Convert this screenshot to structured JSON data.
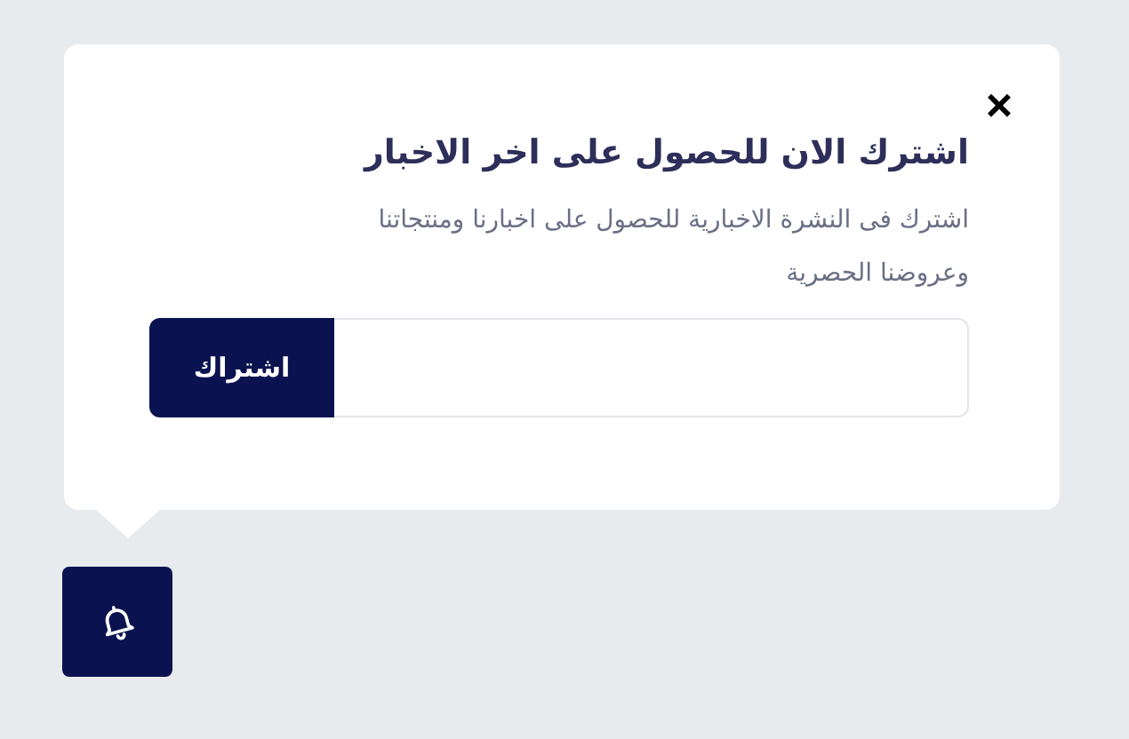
{
  "popup": {
    "close": "×",
    "title": "اشترك الان للحصول على اخر الاخبار",
    "description": "اشترك فى النشرة الاخبارية للحصول على اخبارنا ومنتجاتنا وعروضنا الحصرية",
    "subscribe_button": "اشتراك"
  }
}
